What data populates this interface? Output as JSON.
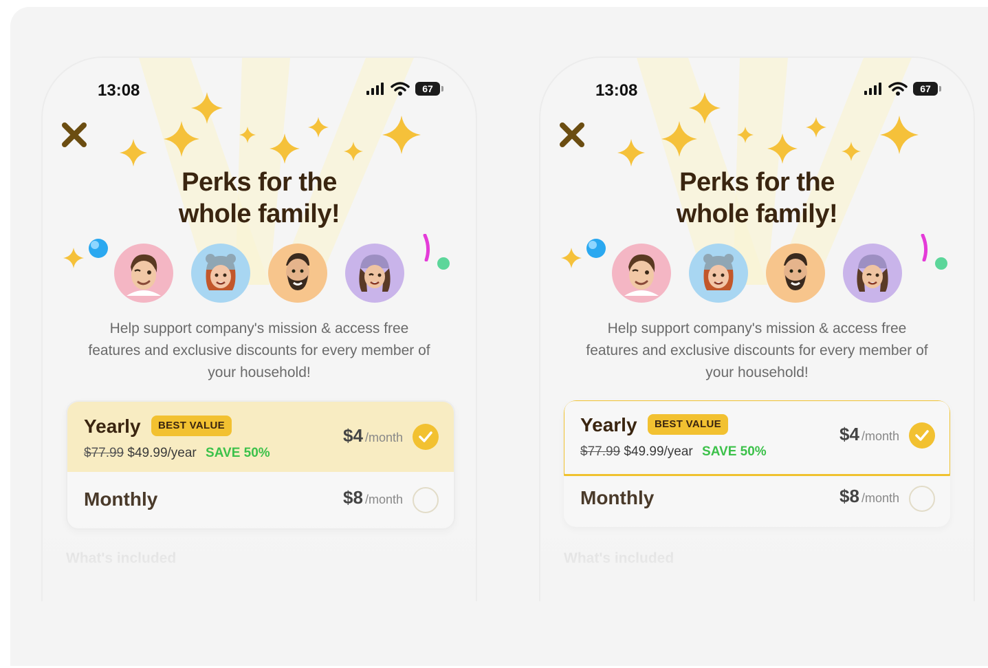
{
  "screens": [
    {
      "status": {
        "time": "13:08",
        "battery": "67"
      },
      "title_line1": "Perks for the",
      "title_line2": "whole family!",
      "description": "Help support company's mission & access free features and exclusive discounts for every member of your household!",
      "plans": {
        "yearly": {
          "name": "Yearly",
          "badge": "BEST VALUE",
          "old_price": "$77.99",
          "year_price": "$49.99/year",
          "save": "SAVE 50%",
          "price": "$4",
          "period": "/month",
          "selected": true
        },
        "monthly": {
          "name": "Monthly",
          "price": "$8",
          "period": "/month",
          "selected": false
        }
      },
      "included_label": "What's included"
    },
    {
      "status": {
        "time": "13:08",
        "battery": "67"
      },
      "title_line1": "Perks for the",
      "title_line2": "whole family!",
      "description": "Help support company's mission & access free features and exclusive discounts for every member of your household!",
      "plans": {
        "yearly": {
          "name": "Yearly",
          "badge": "BEST VALUE",
          "old_price": "$77.99",
          "year_price": "$49.99/year",
          "save": "SAVE 50%",
          "price": "$4",
          "period": "/month",
          "selected": true
        },
        "monthly": {
          "name": "Monthly",
          "price": "$8",
          "period": "/month",
          "selected": false
        }
      },
      "included_label": "What's included"
    }
  ],
  "icons": [
    "close-icon",
    "signal-icon",
    "wifi-icon",
    "battery-icon",
    "sparkle-icon",
    "avatar-icon",
    "checkmark-icon"
  ],
  "colors": {
    "accent": "#f2c131",
    "title": "#3a2510",
    "save": "#3cc14a",
    "yearly_bg": "#f8ecc2",
    "outline": "#f0c22f"
  }
}
